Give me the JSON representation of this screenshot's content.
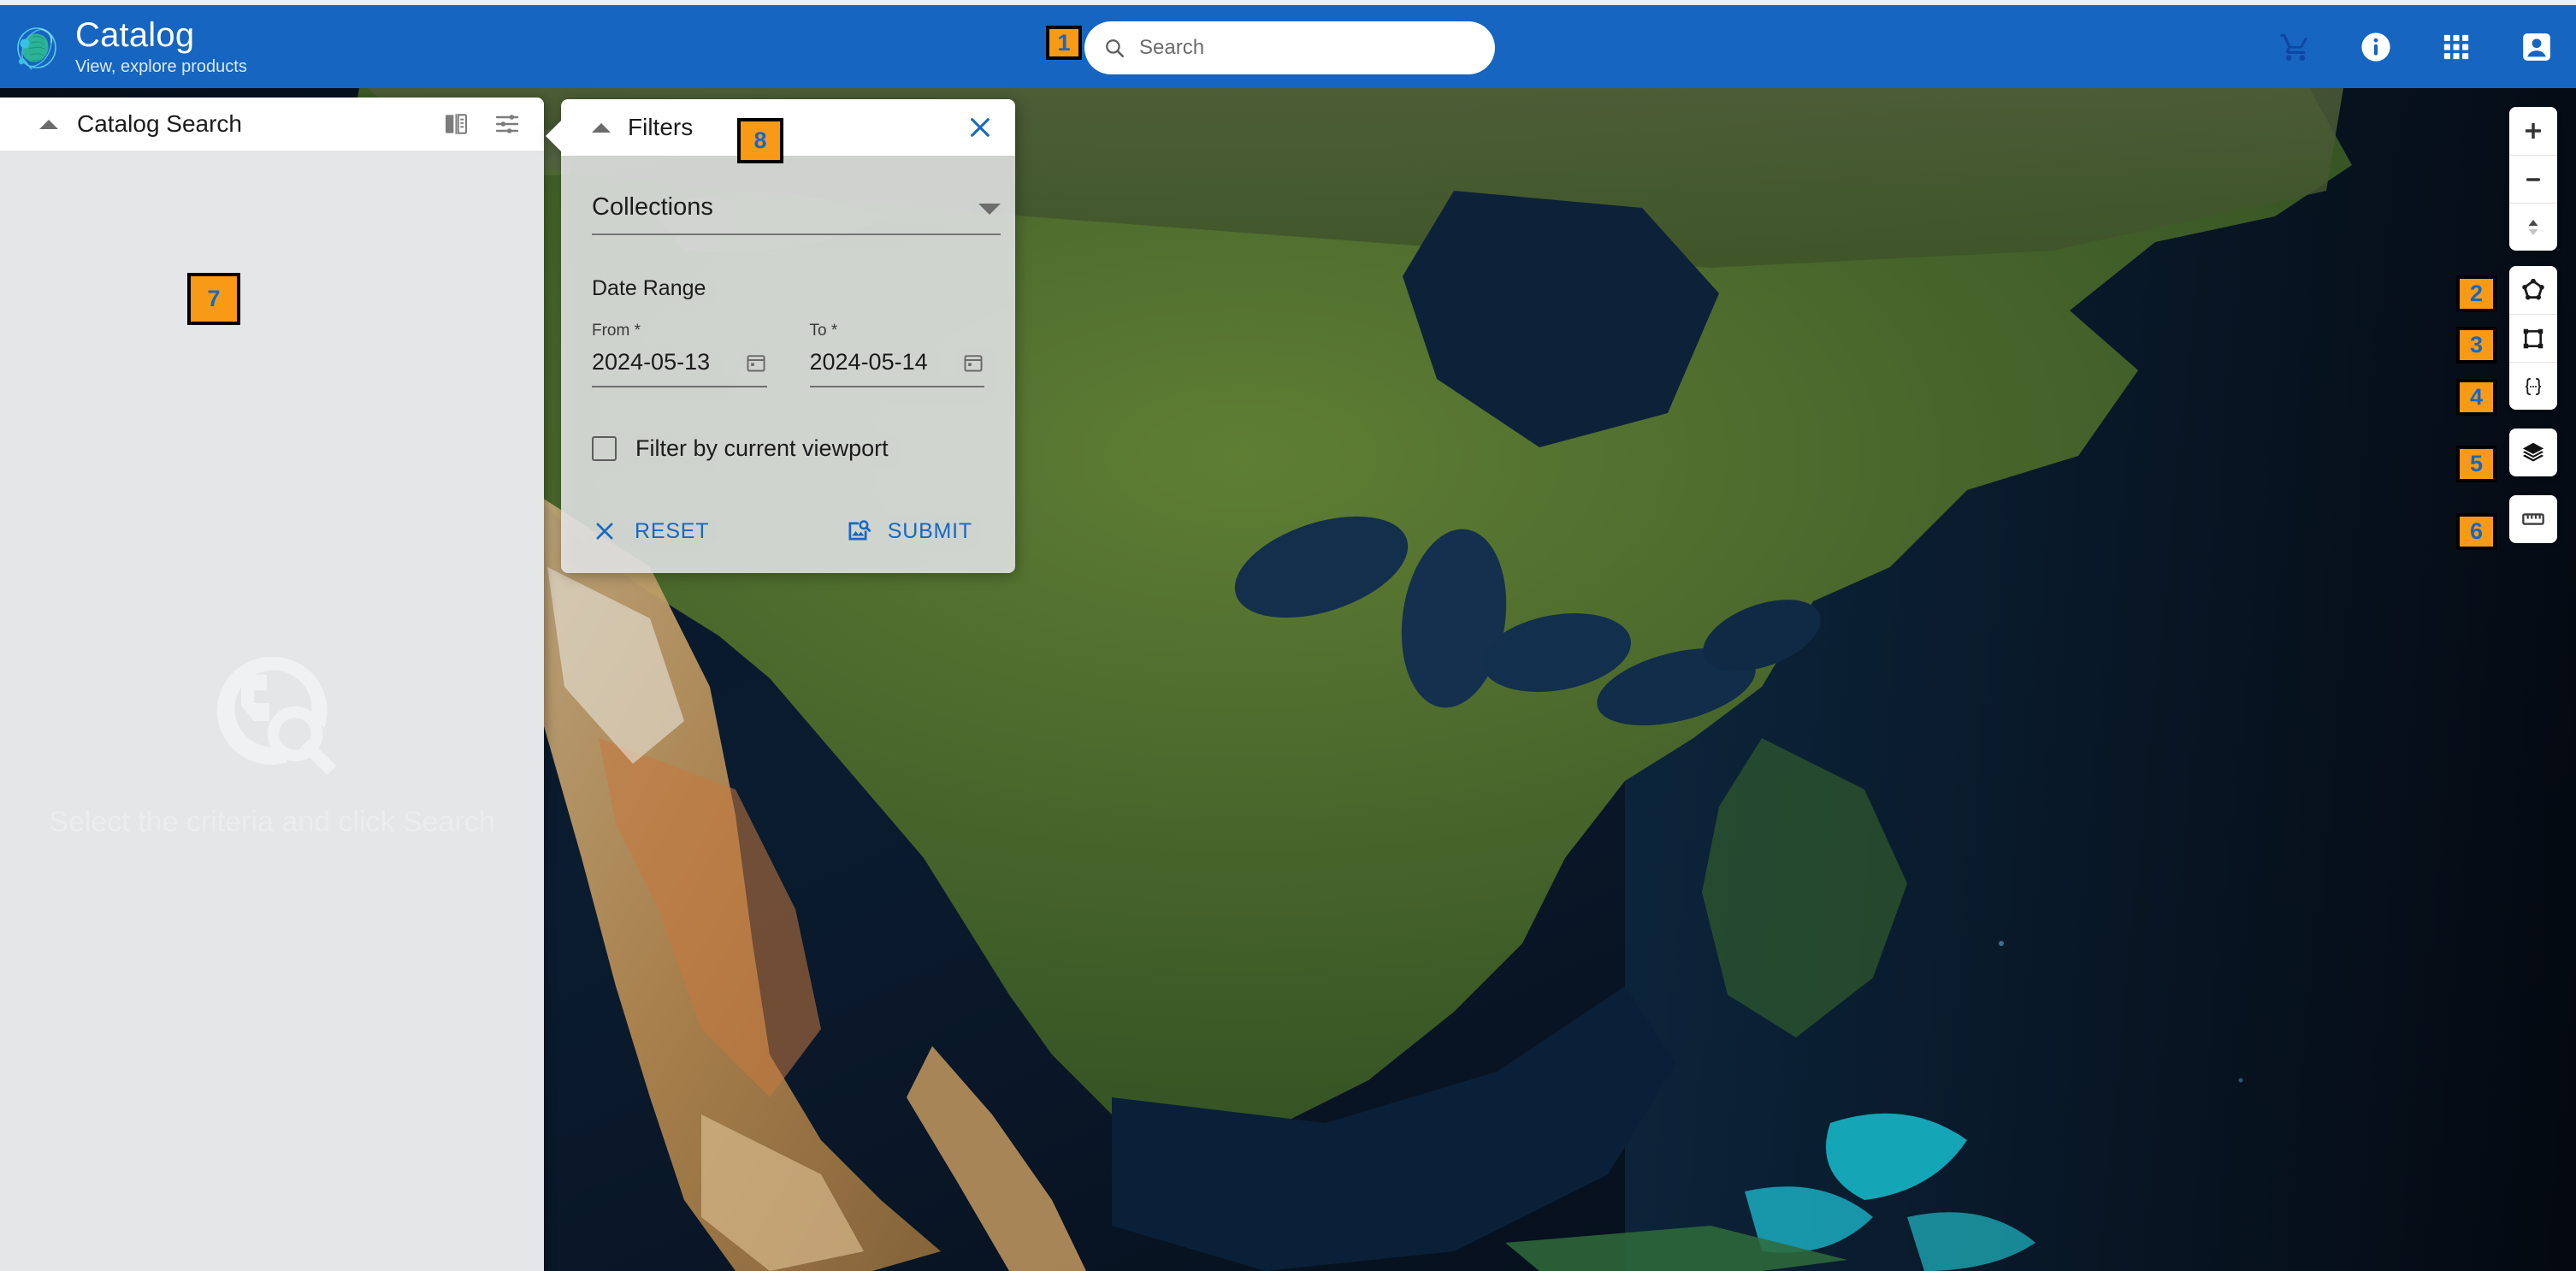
{
  "header": {
    "logo_icon": "globe-orbit-logo",
    "title": "Catalog",
    "subtitle": "View, explore products",
    "search": {
      "icon": "search-icon",
      "placeholder": "Search",
      "value": ""
    },
    "actions": [
      {
        "icon": "shopping-cart-icon",
        "name": "cart-button"
      },
      {
        "icon": "info-circle-icon",
        "name": "info-button"
      },
      {
        "icon": "apps-grid-icon",
        "name": "apps-button"
      },
      {
        "icon": "account-box-icon",
        "name": "account-button"
      }
    ]
  },
  "left_panel": {
    "title": "Catalog Search",
    "collapse_icon": "caret-up-icon",
    "tools": [
      {
        "icon": "compare-split-icon",
        "name": "compare-button"
      },
      {
        "icon": "tune-sliders-icon",
        "name": "tune-button"
      }
    ],
    "empty_state": {
      "icon": "globe-search-icon",
      "text": "Select the criteria and click Search"
    }
  },
  "filters": {
    "title": "Filters",
    "collapse_icon": "caret-up-icon",
    "close_icon": "close-x-icon",
    "collections": {
      "label": "Collections",
      "value": "",
      "dropdown_icon": "chevron-down-icon"
    },
    "date_range": {
      "section_label": "Date Range",
      "from": {
        "label": "From *",
        "value": "2024-05-13",
        "icon": "calendar-icon"
      },
      "to": {
        "label": "To *",
        "value": "2024-05-14",
        "icon": "calendar-icon"
      }
    },
    "viewport_filter": {
      "label": "Filter by current viewport",
      "checked": false
    },
    "buttons": {
      "reset": {
        "label": "RESET",
        "icon": "close-x-icon"
      },
      "submit": {
        "label": "SUBMIT",
        "icon": "image-search-icon"
      }
    }
  },
  "map_controls": {
    "zoom_in": {
      "icon": "plus-icon",
      "label": "+"
    },
    "zoom_out": {
      "icon": "minus-icon",
      "label": "−"
    },
    "tilt": {
      "icon": "tilt-arrows-icon"
    },
    "draw_polygon": {
      "icon": "polygon-draw-icon"
    },
    "draw_bbox": {
      "icon": "bounding-box-icon"
    },
    "geojson": {
      "icon": "curly-braces-icon",
      "label": "{...}"
    },
    "layers": {
      "icon": "layers-stack-icon"
    },
    "measure": {
      "icon": "ruler-icon"
    }
  },
  "badges": {
    "b1": "1",
    "b2": "2",
    "b3": "3",
    "b4": "4",
    "b5": "5",
    "b6": "6",
    "b7": "7",
    "b8": "8"
  },
  "colors": {
    "header_blue": "#1665c1",
    "accent_blue": "#1668c4",
    "badge_orange": "#f99a16",
    "panel_gray": "#e5e6e7",
    "map_ocean": "#0a1628"
  }
}
